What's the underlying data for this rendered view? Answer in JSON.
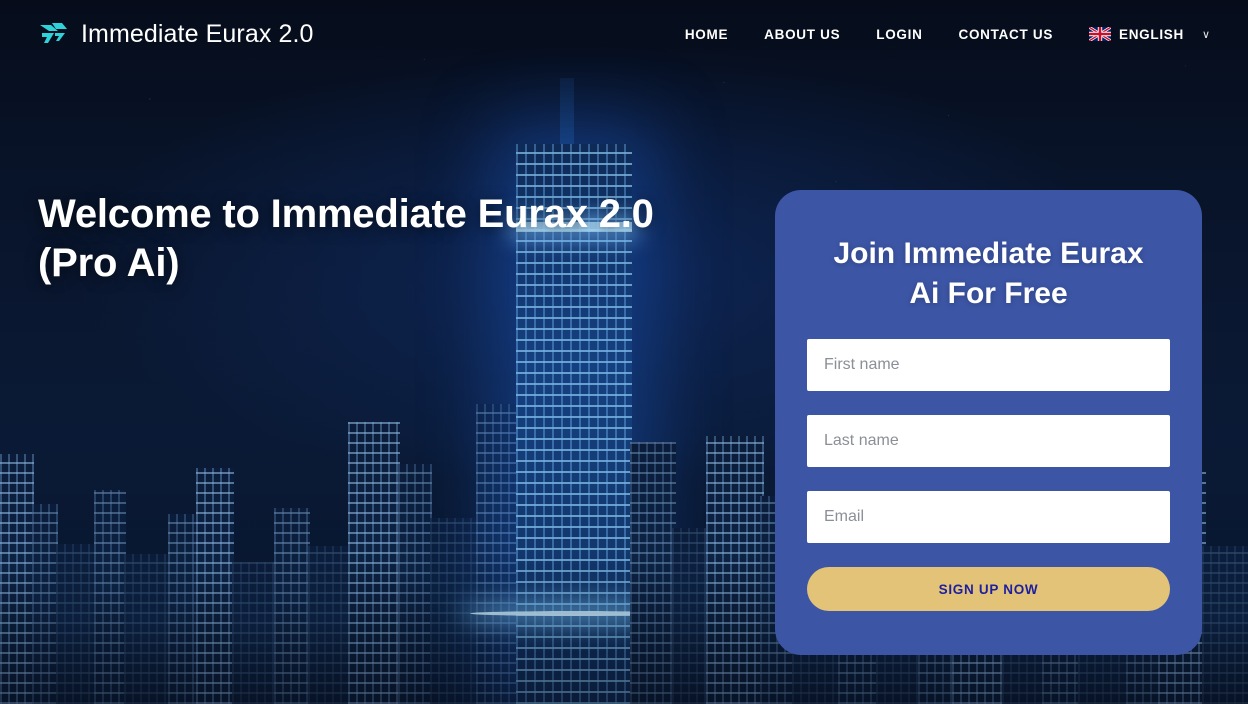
{
  "brand": {
    "name": "Immediate Eurax 2.0",
    "logo_icon": "bird-arrow-logo-icon",
    "logo_color": "#2fd2d9"
  },
  "nav": {
    "items": [
      {
        "label": "HOME"
      },
      {
        "label": "ABOUT US"
      },
      {
        "label": "LOGIN"
      },
      {
        "label": "CONTACT US"
      }
    ],
    "language": {
      "label": "ENGLISH",
      "flag_icon": "uk-flag-icon",
      "chevron_icon": "chevron-down-icon",
      "chevron_glyph": "∨"
    }
  },
  "hero": {
    "heading_line1": "Welcome to Immediate Eurax 2.0",
    "heading_line2": "(Pro Ai)",
    "heading_full": "Welcome to Immediate Eurax 2.0 (Pro Ai)"
  },
  "signup": {
    "title_line1": "Join Immediate Eurax",
    "title_line2": "Ai For Free",
    "fields": {
      "first_name": {
        "placeholder": "First name",
        "value": ""
      },
      "last_name": {
        "placeholder": "Last name",
        "value": ""
      },
      "email": {
        "placeholder": "Email",
        "value": ""
      }
    },
    "submit_label": "SIGN UP NOW"
  },
  "colors": {
    "card_background": "#3c55a5",
    "button_background": "#e3c378",
    "button_text": "#1d1fa0",
    "page_background": "#0a1730",
    "nav_text": "#ffffff",
    "placeholder_text": "#8b8f96"
  }
}
